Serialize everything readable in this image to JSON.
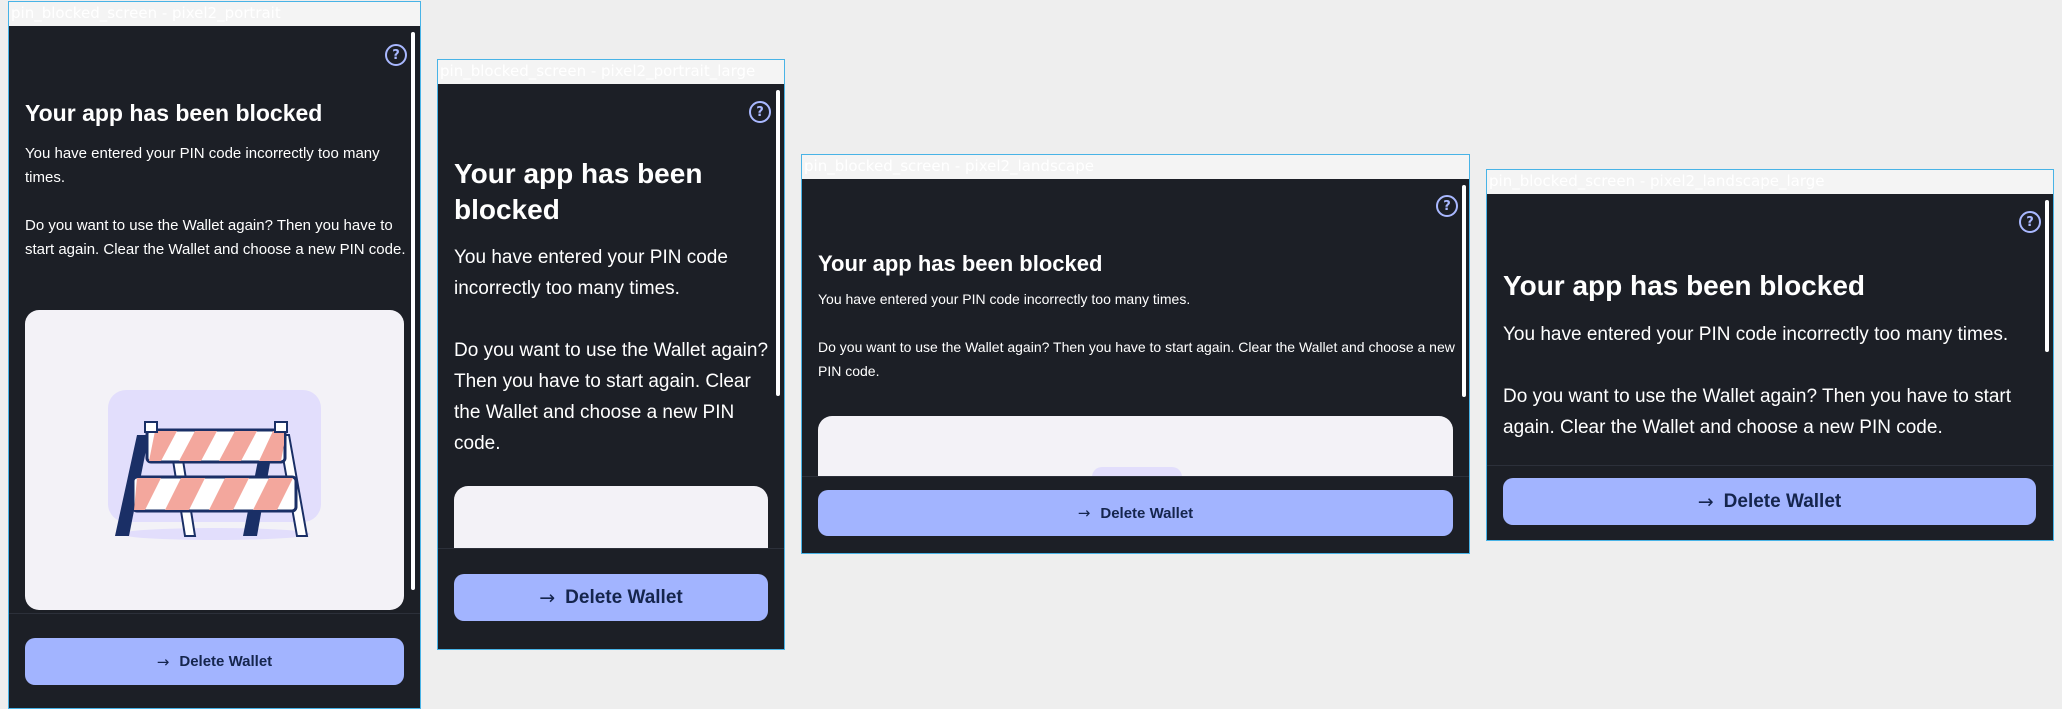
{
  "frames": {
    "portrait": {
      "label": "pin_blocked_screen - pixel2_portrait"
    },
    "portrait_large": {
      "label": "pin_blocked_screen - pixel2_portrait_large"
    },
    "landscape": {
      "label": "pin_blocked_screen - pixel2_landscape"
    },
    "landscape_large": {
      "label": "pin_blocked_screen - pixel2_landscape_large"
    }
  },
  "screen": {
    "help_icon": "question-circle-icon",
    "help_glyph": "?",
    "title": "Your app has been blocked",
    "paragraph_1": "You have entered your PIN code incorrectly too many times.",
    "paragraph_2": "Do you want to use the Wallet again? Then you have to start again. Clear the Wallet and choose a new PIN code.",
    "illustration": "road-barrier-illustration",
    "delete_button_label": "Delete Wallet",
    "delete_button_icon": "arrow-right-icon",
    "arrow_glyph": "→"
  },
  "colors": {
    "background": "#1c1f26",
    "accent": "#a2b4ff",
    "button_text": "#15254d",
    "card": "#f3f2f7",
    "barrier_stripe": "#f3a79d",
    "barrier_dark": "#1a2f66",
    "frame_border": "#48b3e6"
  }
}
